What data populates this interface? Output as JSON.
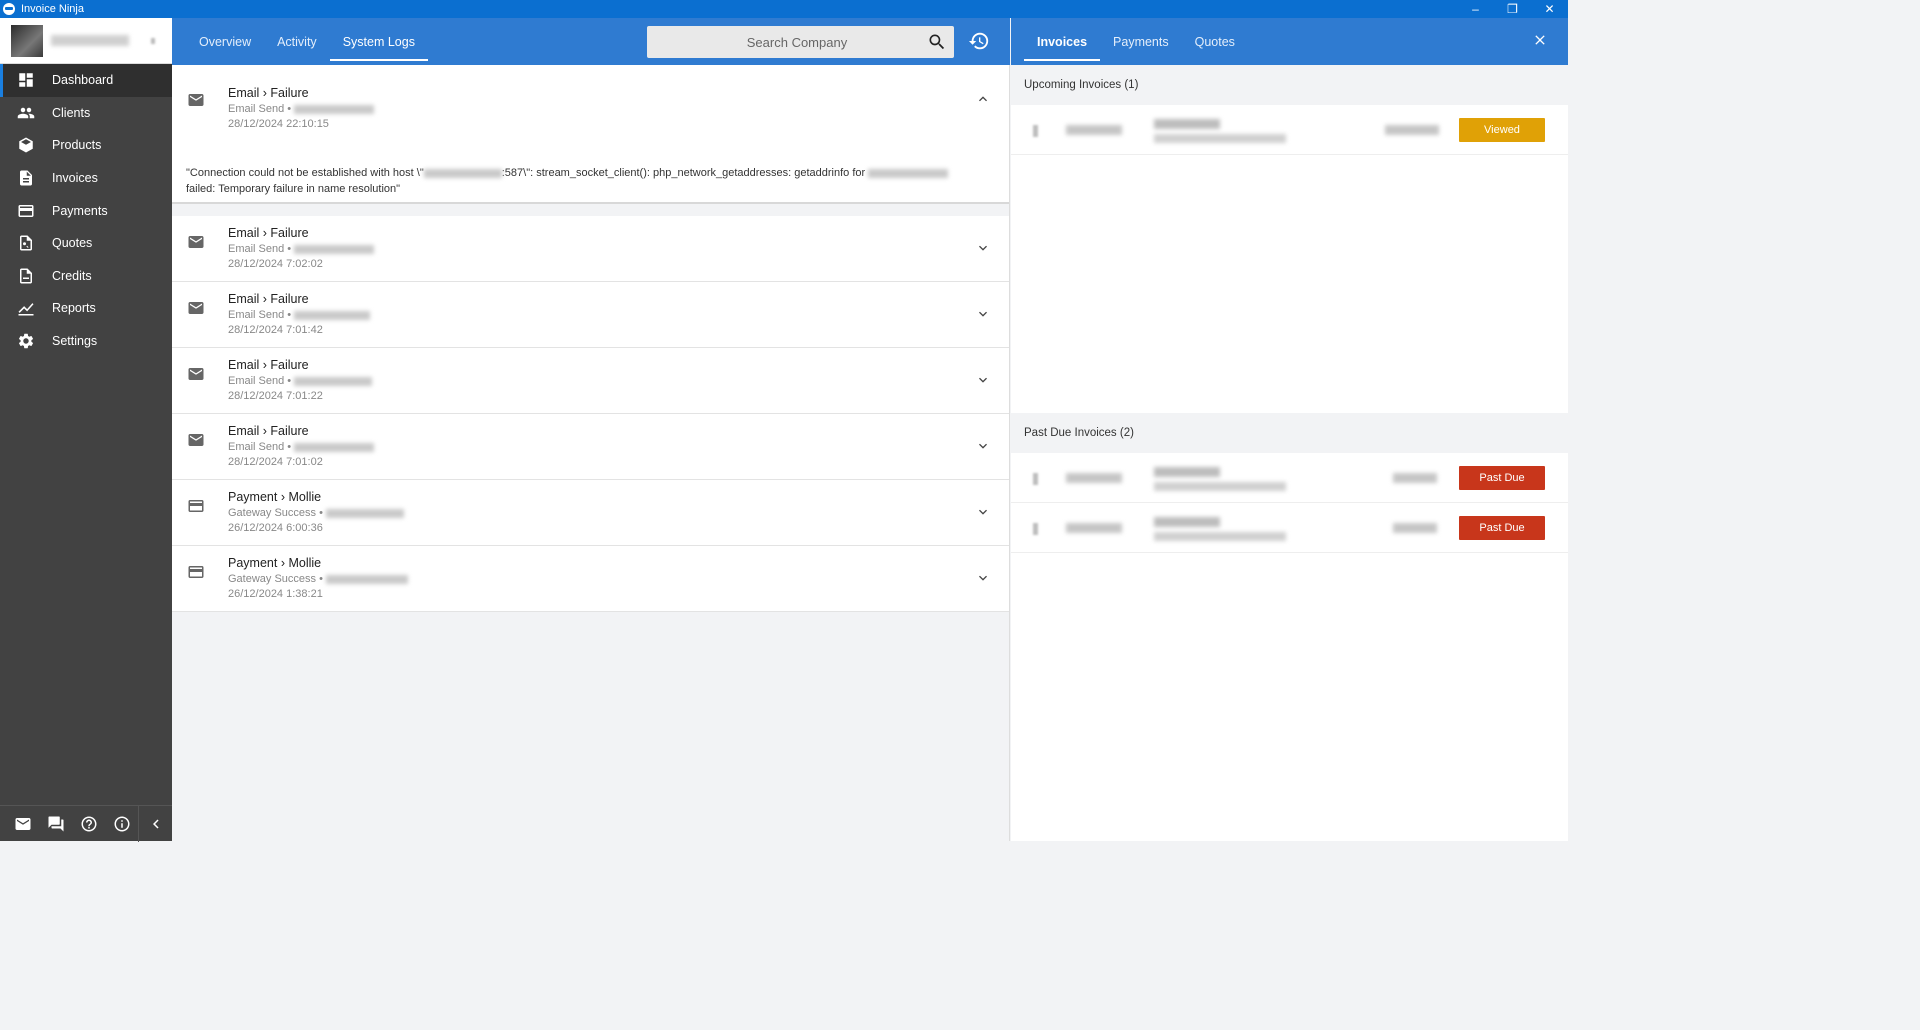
{
  "window": {
    "title": "Invoice Ninja",
    "minimize": "–",
    "maximize": "❐",
    "close": "✕"
  },
  "sidebar": {
    "items": [
      {
        "label": "Dashboard",
        "icon": "dashboard-icon",
        "active": true
      },
      {
        "label": "Clients",
        "icon": "clients-icon"
      },
      {
        "label": "Products",
        "icon": "products-icon"
      },
      {
        "label": "Invoices",
        "icon": "invoices-icon"
      },
      {
        "label": "Payments",
        "icon": "payments-icon"
      },
      {
        "label": "Quotes",
        "icon": "quotes-icon"
      },
      {
        "label": "Credits",
        "icon": "credits-icon"
      },
      {
        "label": "Reports",
        "icon": "reports-icon"
      },
      {
        "label": "Settings",
        "icon": "settings-icon"
      }
    ]
  },
  "header": {
    "tabs": [
      {
        "label": "Overview"
      },
      {
        "label": "Activity"
      },
      {
        "label": "System Logs",
        "active": true
      }
    ],
    "search_placeholder": "Search Company"
  },
  "logs": [
    {
      "category": "Email",
      "type": "Failure",
      "event": "Email Send •",
      "date": "28/12/2024 22:10:15",
      "icon": "mail-icon",
      "expanded": true,
      "message_start": "\"Connection could not be established with host \\\"",
      "message_port": ":587\\\": stream_socket_client(): php_network_getaddresses: getaddrinfo for ",
      "message_end": "failed: Temporary failure in name resolution\""
    },
    {
      "category": "Email",
      "type": "Failure",
      "event": "Email Send •",
      "date": "28/12/2024 7:02:02",
      "icon": "mail-icon"
    },
    {
      "category": "Email",
      "type": "Failure",
      "event": "Email Send •",
      "date": "28/12/2024 7:01:42",
      "icon": "mail-icon"
    },
    {
      "category": "Email",
      "type": "Failure",
      "event": "Email Send •",
      "date": "28/12/2024 7:01:22",
      "icon": "mail-icon"
    },
    {
      "category": "Email",
      "type": "Failure",
      "event": "Email Send •",
      "date": "28/12/2024 7:01:02",
      "icon": "mail-icon"
    },
    {
      "category": "Payment",
      "type": "Mollie",
      "event": "Gateway Success •",
      "date": "26/12/2024 6:00:36",
      "icon": "card-icon"
    },
    {
      "category": "Payment",
      "type": "Mollie",
      "event": "Gateway Success •",
      "date": "26/12/2024 1:38:21",
      "icon": "card-icon"
    }
  ],
  "breadcrumb_separator": "›",
  "right_panel": {
    "tabs": [
      {
        "label": "Invoices",
        "active": true
      },
      {
        "label": "Payments"
      },
      {
        "label": "Quotes"
      }
    ],
    "upcoming_title": "Upcoming Invoices (1)",
    "past_due_title": "Past Due Invoices (2)",
    "upcoming": [
      {
        "status": "Viewed"
      }
    ],
    "past_due": [
      {
        "status": "Past Due"
      },
      {
        "status": "Past Due"
      }
    ]
  },
  "colors": {
    "accent": "#2f7bd1",
    "sidebar": "#424242",
    "viewed": "#e0a106",
    "past_due": "#c8361b"
  }
}
